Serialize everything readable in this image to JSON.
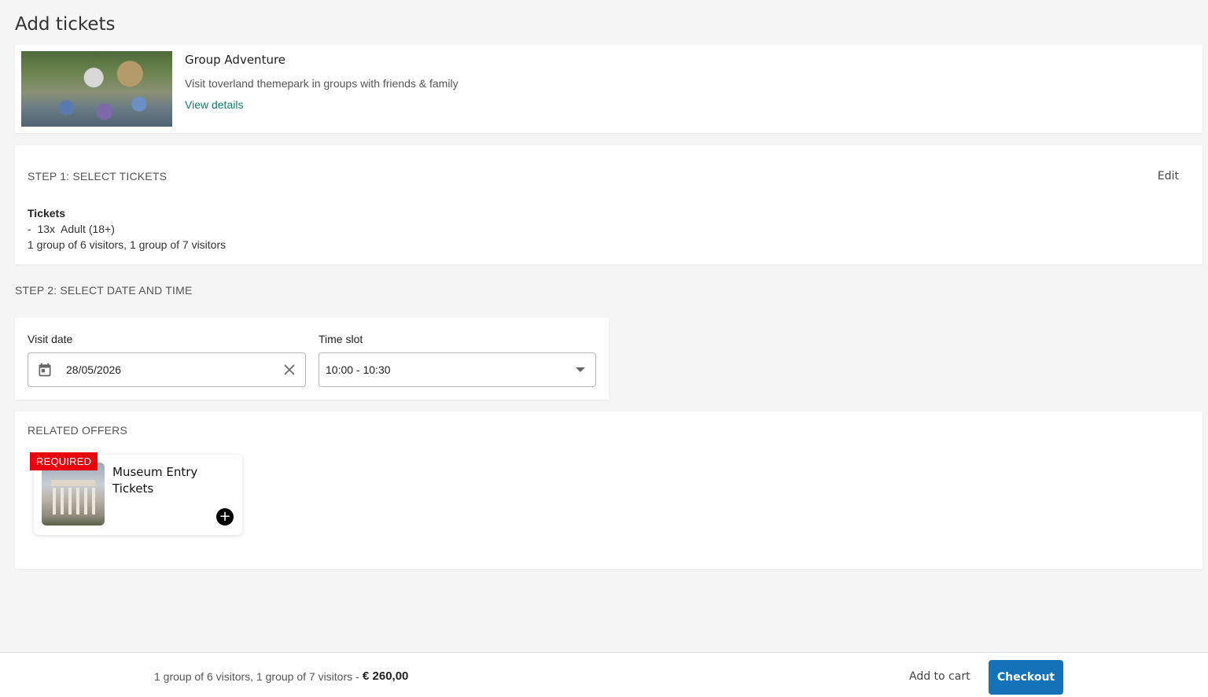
{
  "page": {
    "title": "Add tickets"
  },
  "product": {
    "name": "Group Adventure",
    "description": "Visit toverland themepark in groups with friends & family",
    "view_details": "View details"
  },
  "step1": {
    "heading": "STEP 1: SELECT TICKETS",
    "edit_label": "Edit",
    "tickets_label": "Tickets",
    "ticket_line": "-  13x  Adult (18+)",
    "groups_line": "1 group of 6 visitors, 1 group of 7 visitors"
  },
  "step2": {
    "heading": "STEP 2: SELECT DATE AND TIME",
    "visit_date_label": "Visit date",
    "visit_date_value": "28/05/2026",
    "time_slot_label": "Time slot",
    "time_slot_value": "10:00 - 10:30"
  },
  "related": {
    "heading": "RELATED OFFERS",
    "offers": [
      {
        "badge": "REQUIRED",
        "title": "Museum Entry Tickets",
        "add_icon": "plus-icon"
      }
    ]
  },
  "footer": {
    "summary": "1 group of 6 visitors, 1 group of 7 visitors",
    "separator": "-",
    "price": "€ 260,00",
    "add_to_cart": "Add to cart",
    "checkout": "Checkout"
  },
  "colors": {
    "link_green": "#11806a",
    "required_red": "#e8000b",
    "checkout_blue": "#1473b8"
  }
}
